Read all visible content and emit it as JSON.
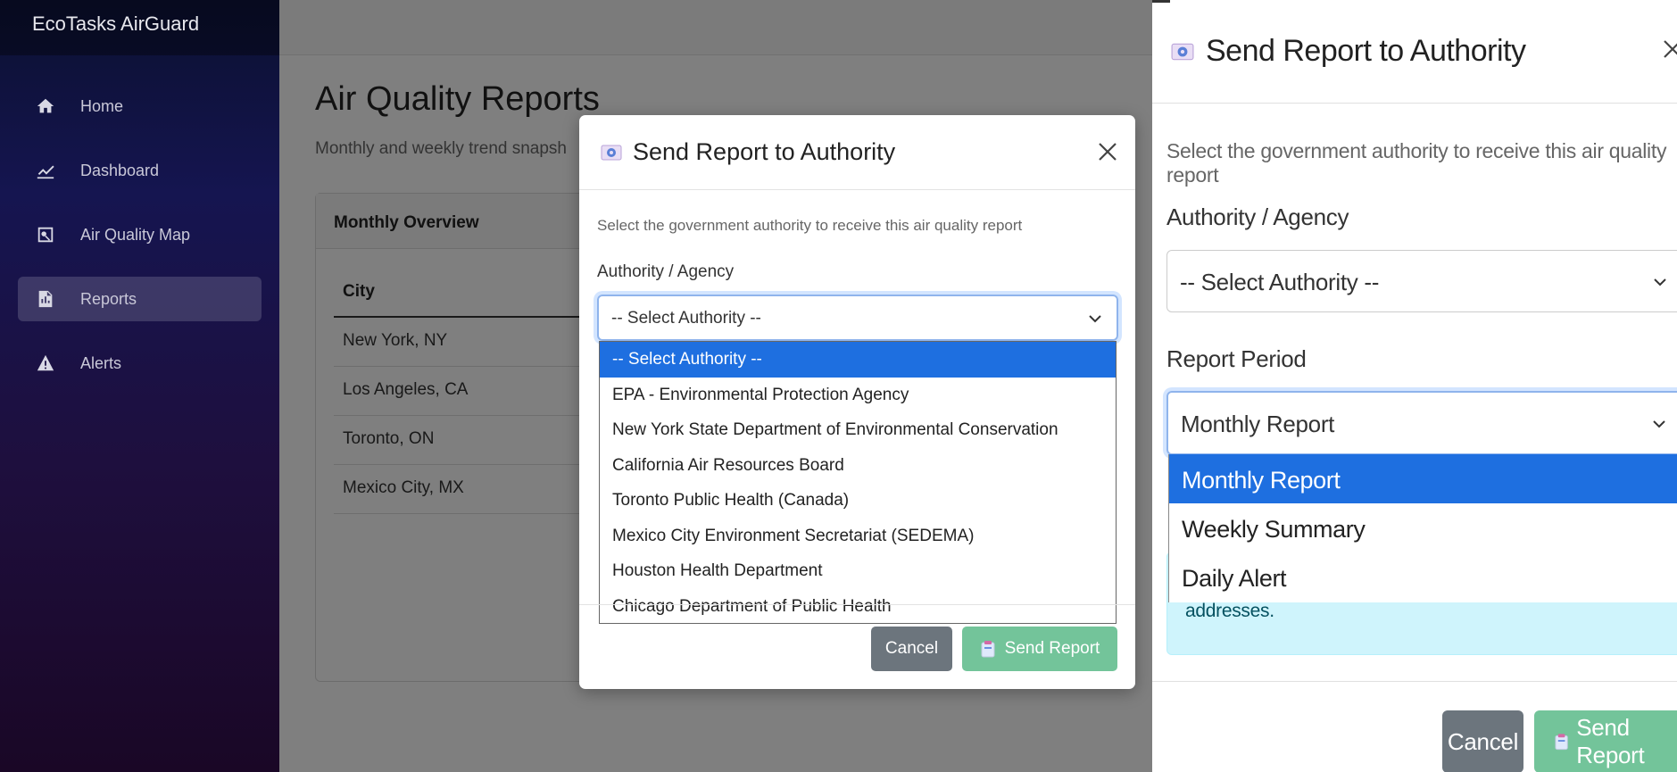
{
  "app": {
    "brand": "EcoTasks AirGuard"
  },
  "sidebar": {
    "items": [
      {
        "label": "Home",
        "icon": "home-icon"
      },
      {
        "label": "Dashboard",
        "icon": "chart-line-icon"
      },
      {
        "label": "Air Quality Map",
        "icon": "map-icon"
      },
      {
        "label": "Reports",
        "icon": "report-icon",
        "active": true
      },
      {
        "label": "Alerts",
        "icon": "warning-icon"
      }
    ]
  },
  "page": {
    "title": "Air Quality Reports",
    "subtitle": "Monthly and weekly trend snapsh",
    "card_title": "Monthly Overview",
    "table": {
      "header": "City",
      "rows": [
        "New York, NY",
        "Los Angeles, CA",
        "Toronto, ON",
        "Mexico City, MX"
      ]
    }
  },
  "modal": {
    "title": "Send Report to Authority",
    "description": "Select the government authority to receive this air quality report",
    "authority_label": "Authority / Agency",
    "authority_selected": "-- Select Authority --",
    "authority_options": [
      "-- Select Authority --",
      "EPA - Environmental Protection Agency",
      "New York State Department of Environmental Conservation",
      "California Air Resources Board",
      "Toronto Public Health (Canada)",
      "Mexico City Environment Secretariat (SEDEMA)",
      "Houston Health Department",
      "Chicago Department of Public Health"
    ],
    "cancel_label": "Cancel",
    "send_label": "Send Report"
  },
  "zoom_panel": {
    "title": "Send Report to Authority",
    "description": "Select the government authority to receive this air quality report",
    "authority_label": "Authority / Agency",
    "authority_selected": "-- Select Authority --",
    "period_label": "Report Period",
    "period_selected": "Monthly Report",
    "period_options": [
      "Monthly Report",
      "Weekly Summary",
      "Daily Alert"
    ],
    "info_text": "addresses.",
    "cancel_label": "Cancel",
    "send_label": "Send Report"
  },
  "colors": {
    "primary": "#1e6fe0",
    "success": "#73c49a",
    "secondary": "#6c757d",
    "info_bg": "#cff4fc"
  }
}
